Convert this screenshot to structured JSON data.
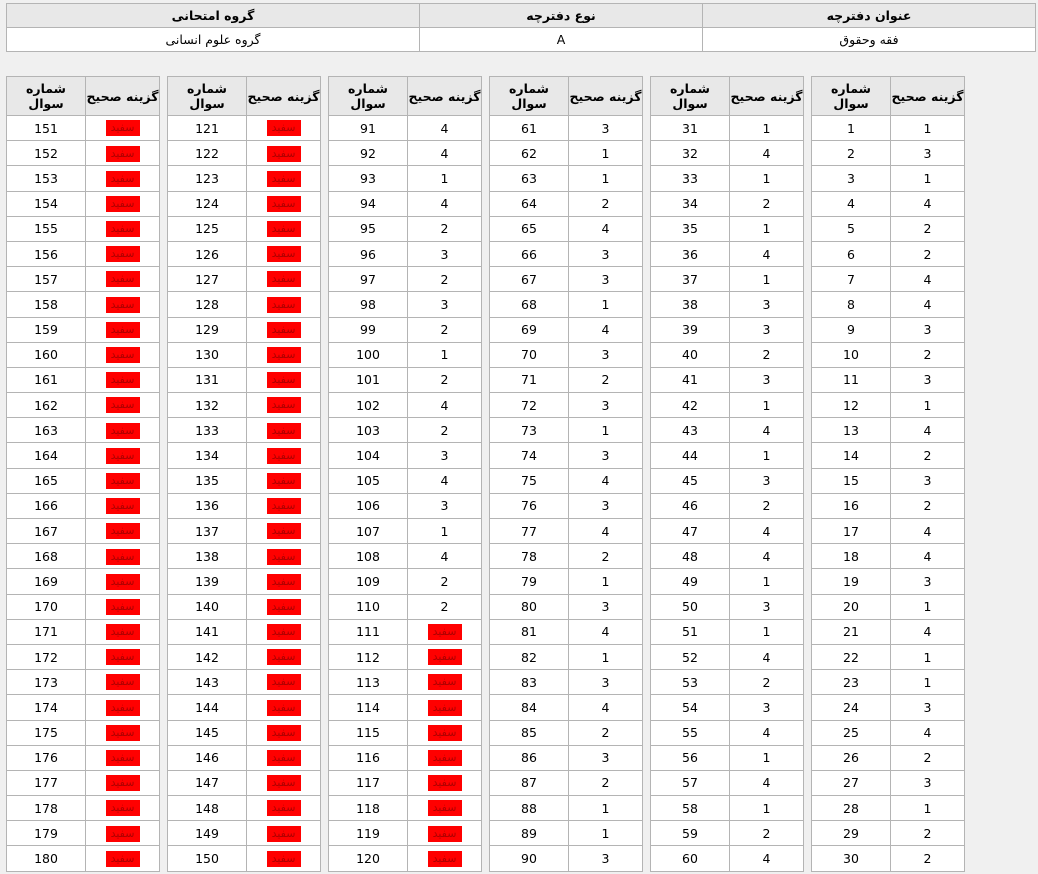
{
  "header": {
    "col_group_label": "گروه امتحانی",
    "col_type_label": "نوع دفترچه",
    "col_title_label": "عنوان دفترچه",
    "group_value": "گروه علوم انسانی",
    "type_value": "A",
    "title_value": "فقه وحقوق"
  },
  "answers": {
    "question_header": "شماره سوال",
    "answer_header": "گزینه صحیح",
    "blank_label": "سفید",
    "blank_color": "#ff0000",
    "columns": [
      [
        [
          "1",
          "1"
        ],
        [
          "2",
          "3"
        ],
        [
          "3",
          "1"
        ],
        [
          "4",
          "4"
        ],
        [
          "5",
          "2"
        ],
        [
          "6",
          "2"
        ],
        [
          "7",
          "4"
        ],
        [
          "8",
          "4"
        ],
        [
          "9",
          "3"
        ],
        [
          "10",
          "2"
        ],
        [
          "11",
          "3"
        ],
        [
          "12",
          "1"
        ],
        [
          "13",
          "4"
        ],
        [
          "14",
          "2"
        ],
        [
          "15",
          "3"
        ],
        [
          "16",
          "2"
        ],
        [
          "17",
          "4"
        ],
        [
          "18",
          "4"
        ],
        [
          "19",
          "3"
        ],
        [
          "20",
          "1"
        ],
        [
          "21",
          "4"
        ],
        [
          "22",
          "1"
        ],
        [
          "23",
          "1"
        ],
        [
          "24",
          "3"
        ],
        [
          "25",
          "4"
        ],
        [
          "26",
          "2"
        ],
        [
          "27",
          "3"
        ],
        [
          "28",
          "1"
        ],
        [
          "29",
          "2"
        ],
        [
          "30",
          "2"
        ]
      ],
      [
        [
          "31",
          "1"
        ],
        [
          "32",
          "4"
        ],
        [
          "33",
          "1"
        ],
        [
          "34",
          "2"
        ],
        [
          "35",
          "1"
        ],
        [
          "36",
          "4"
        ],
        [
          "37",
          "1"
        ],
        [
          "38",
          "3"
        ],
        [
          "39",
          "3"
        ],
        [
          "40",
          "2"
        ],
        [
          "41",
          "3"
        ],
        [
          "42",
          "1"
        ],
        [
          "43",
          "4"
        ],
        [
          "44",
          "1"
        ],
        [
          "45",
          "3"
        ],
        [
          "46",
          "2"
        ],
        [
          "47",
          "4"
        ],
        [
          "48",
          "4"
        ],
        [
          "49",
          "1"
        ],
        [
          "50",
          "3"
        ],
        [
          "51",
          "1"
        ],
        [
          "52",
          "4"
        ],
        [
          "53",
          "2"
        ],
        [
          "54",
          "3"
        ],
        [
          "55",
          "4"
        ],
        [
          "56",
          "1"
        ],
        [
          "57",
          "4"
        ],
        [
          "58",
          "1"
        ],
        [
          "59",
          "2"
        ],
        [
          "60",
          "4"
        ]
      ],
      [
        [
          "61",
          "3"
        ],
        [
          "62",
          "1"
        ],
        [
          "63",
          "1"
        ],
        [
          "64",
          "2"
        ],
        [
          "65",
          "4"
        ],
        [
          "66",
          "3"
        ],
        [
          "67",
          "3"
        ],
        [
          "68",
          "1"
        ],
        [
          "69",
          "4"
        ],
        [
          "70",
          "3"
        ],
        [
          "71",
          "2"
        ],
        [
          "72",
          "3"
        ],
        [
          "73",
          "1"
        ],
        [
          "74",
          "3"
        ],
        [
          "75",
          "4"
        ],
        [
          "76",
          "3"
        ],
        [
          "77",
          "4"
        ],
        [
          "78",
          "2"
        ],
        [
          "79",
          "1"
        ],
        [
          "80",
          "3"
        ],
        [
          "81",
          "4"
        ],
        [
          "82",
          "1"
        ],
        [
          "83",
          "3"
        ],
        [
          "84",
          "4"
        ],
        [
          "85",
          "2"
        ],
        [
          "86",
          "3"
        ],
        [
          "87",
          "2"
        ],
        [
          "88",
          "1"
        ],
        [
          "89",
          "1"
        ],
        [
          "90",
          "3"
        ]
      ],
      [
        [
          "91",
          "4"
        ],
        [
          "92",
          "4"
        ],
        [
          "93",
          "1"
        ],
        [
          "94",
          "4"
        ],
        [
          "95",
          "2"
        ],
        [
          "96",
          "3"
        ],
        [
          "97",
          "2"
        ],
        [
          "98",
          "3"
        ],
        [
          "99",
          "2"
        ],
        [
          "100",
          "1"
        ],
        [
          "101",
          "2"
        ],
        [
          "102",
          "4"
        ],
        [
          "103",
          "2"
        ],
        [
          "104",
          "3"
        ],
        [
          "105",
          "4"
        ],
        [
          "106",
          "3"
        ],
        [
          "107",
          "1"
        ],
        [
          "108",
          "4"
        ],
        [
          "109",
          "2"
        ],
        [
          "110",
          "2"
        ],
        [
          "111",
          ""
        ],
        [
          "112",
          ""
        ],
        [
          "113",
          ""
        ],
        [
          "114",
          ""
        ],
        [
          "115",
          ""
        ],
        [
          "116",
          ""
        ],
        [
          "117",
          ""
        ],
        [
          "118",
          ""
        ],
        [
          "119",
          ""
        ],
        [
          "120",
          ""
        ]
      ],
      [
        [
          "121",
          ""
        ],
        [
          "122",
          ""
        ],
        [
          "123",
          ""
        ],
        [
          "124",
          ""
        ],
        [
          "125",
          ""
        ],
        [
          "126",
          ""
        ],
        [
          "127",
          ""
        ],
        [
          "128",
          ""
        ],
        [
          "129",
          ""
        ],
        [
          "130",
          ""
        ],
        [
          "131",
          ""
        ],
        [
          "132",
          ""
        ],
        [
          "133",
          ""
        ],
        [
          "134",
          ""
        ],
        [
          "135",
          ""
        ],
        [
          "136",
          ""
        ],
        [
          "137",
          ""
        ],
        [
          "138",
          ""
        ],
        [
          "139",
          ""
        ],
        [
          "140",
          ""
        ],
        [
          "141",
          ""
        ],
        [
          "142",
          ""
        ],
        [
          "143",
          ""
        ],
        [
          "144",
          ""
        ],
        [
          "145",
          ""
        ],
        [
          "146",
          ""
        ],
        [
          "147",
          ""
        ],
        [
          "148",
          ""
        ],
        [
          "149",
          ""
        ],
        [
          "150",
          ""
        ]
      ],
      [
        [
          "151",
          ""
        ],
        [
          "152",
          ""
        ],
        [
          "153",
          ""
        ],
        [
          "154",
          ""
        ],
        [
          "155",
          ""
        ],
        [
          "156",
          ""
        ],
        [
          "157",
          ""
        ],
        [
          "158",
          ""
        ],
        [
          "159",
          ""
        ],
        [
          "160",
          ""
        ],
        [
          "161",
          ""
        ],
        [
          "162",
          ""
        ],
        [
          "163",
          ""
        ],
        [
          "164",
          ""
        ],
        [
          "165",
          ""
        ],
        [
          "166",
          ""
        ],
        [
          "167",
          ""
        ],
        [
          "168",
          ""
        ],
        [
          "169",
          ""
        ],
        [
          "170",
          ""
        ],
        [
          "171",
          ""
        ],
        [
          "172",
          ""
        ],
        [
          "173",
          ""
        ],
        [
          "174",
          ""
        ],
        [
          "175",
          ""
        ],
        [
          "176",
          ""
        ],
        [
          "177",
          ""
        ],
        [
          "178",
          ""
        ],
        [
          "179",
          ""
        ],
        [
          "180",
          ""
        ]
      ]
    ]
  }
}
